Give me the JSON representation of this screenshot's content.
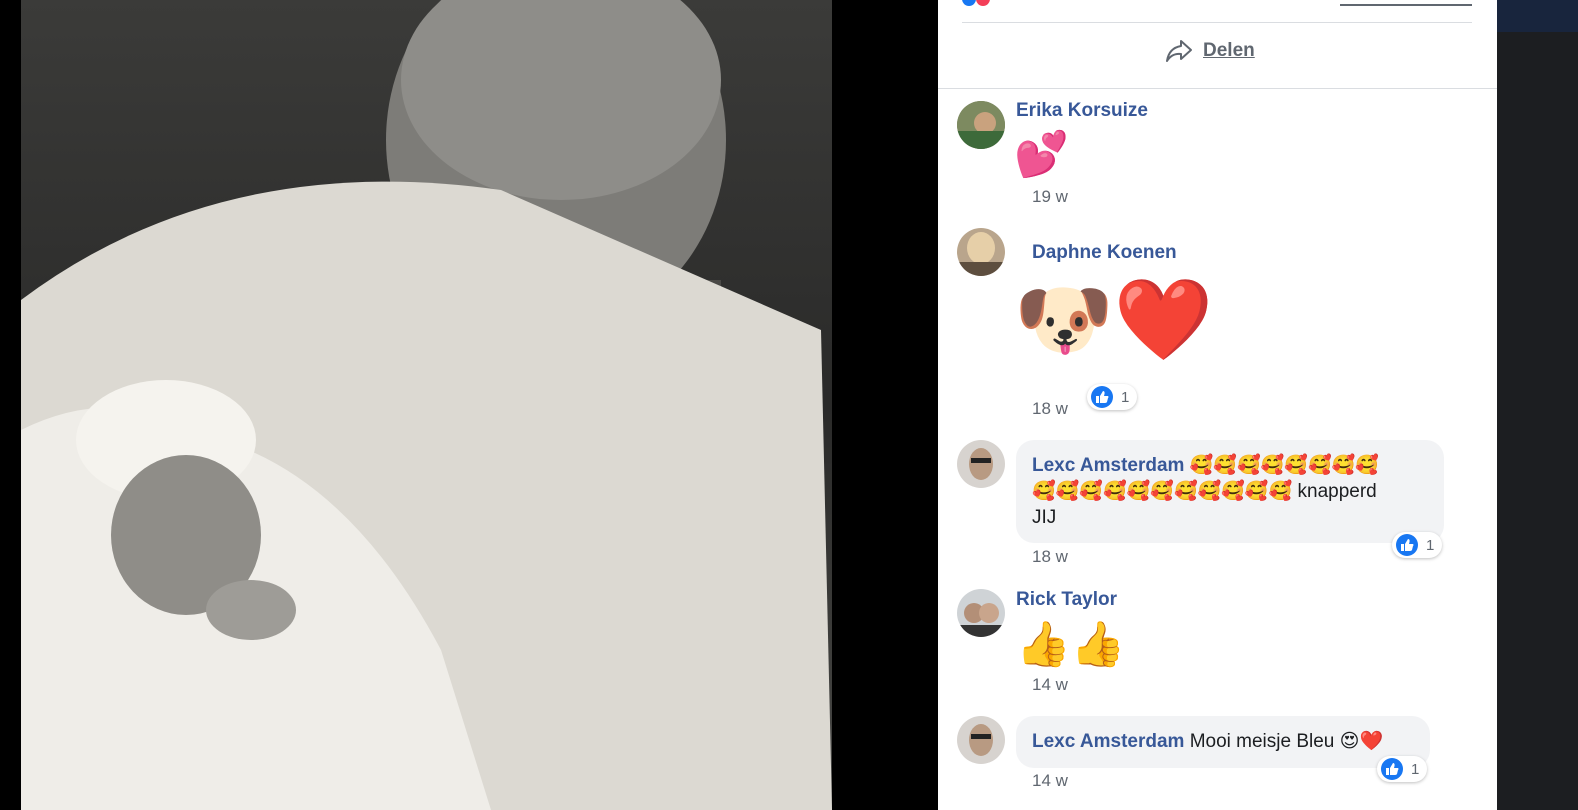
{
  "share": {
    "label": "Delen"
  },
  "comments": [
    {
      "name": "Erika Korsuize",
      "content": "💕",
      "time": "19 w"
    },
    {
      "name": "Daphne Koenen",
      "content": "🐶❤️",
      "time": "18 w",
      "likes": "1"
    },
    {
      "name": "Lexc Amsterdam",
      "text_line1": "🥰🥰🥰🥰🥰🥰🥰🥰",
      "text_line2": "🥰🥰🥰🥰🥰🥰🥰🥰🥰🥰🥰 knapperd",
      "text_line3": "JIJ",
      "time": "18 w",
      "likes": "1"
    },
    {
      "name": "Rick Taylor",
      "content": "👍👍",
      "time": "14 w"
    },
    {
      "name": "Lexc Amsterdam",
      "text": "Mooi meisje Bleu 😍❤️",
      "time": "14 w",
      "likes": "1"
    }
  ],
  "colors": {
    "link": "#385898",
    "like_blue": "#1877f2",
    "bubble": "#f2f3f5"
  }
}
